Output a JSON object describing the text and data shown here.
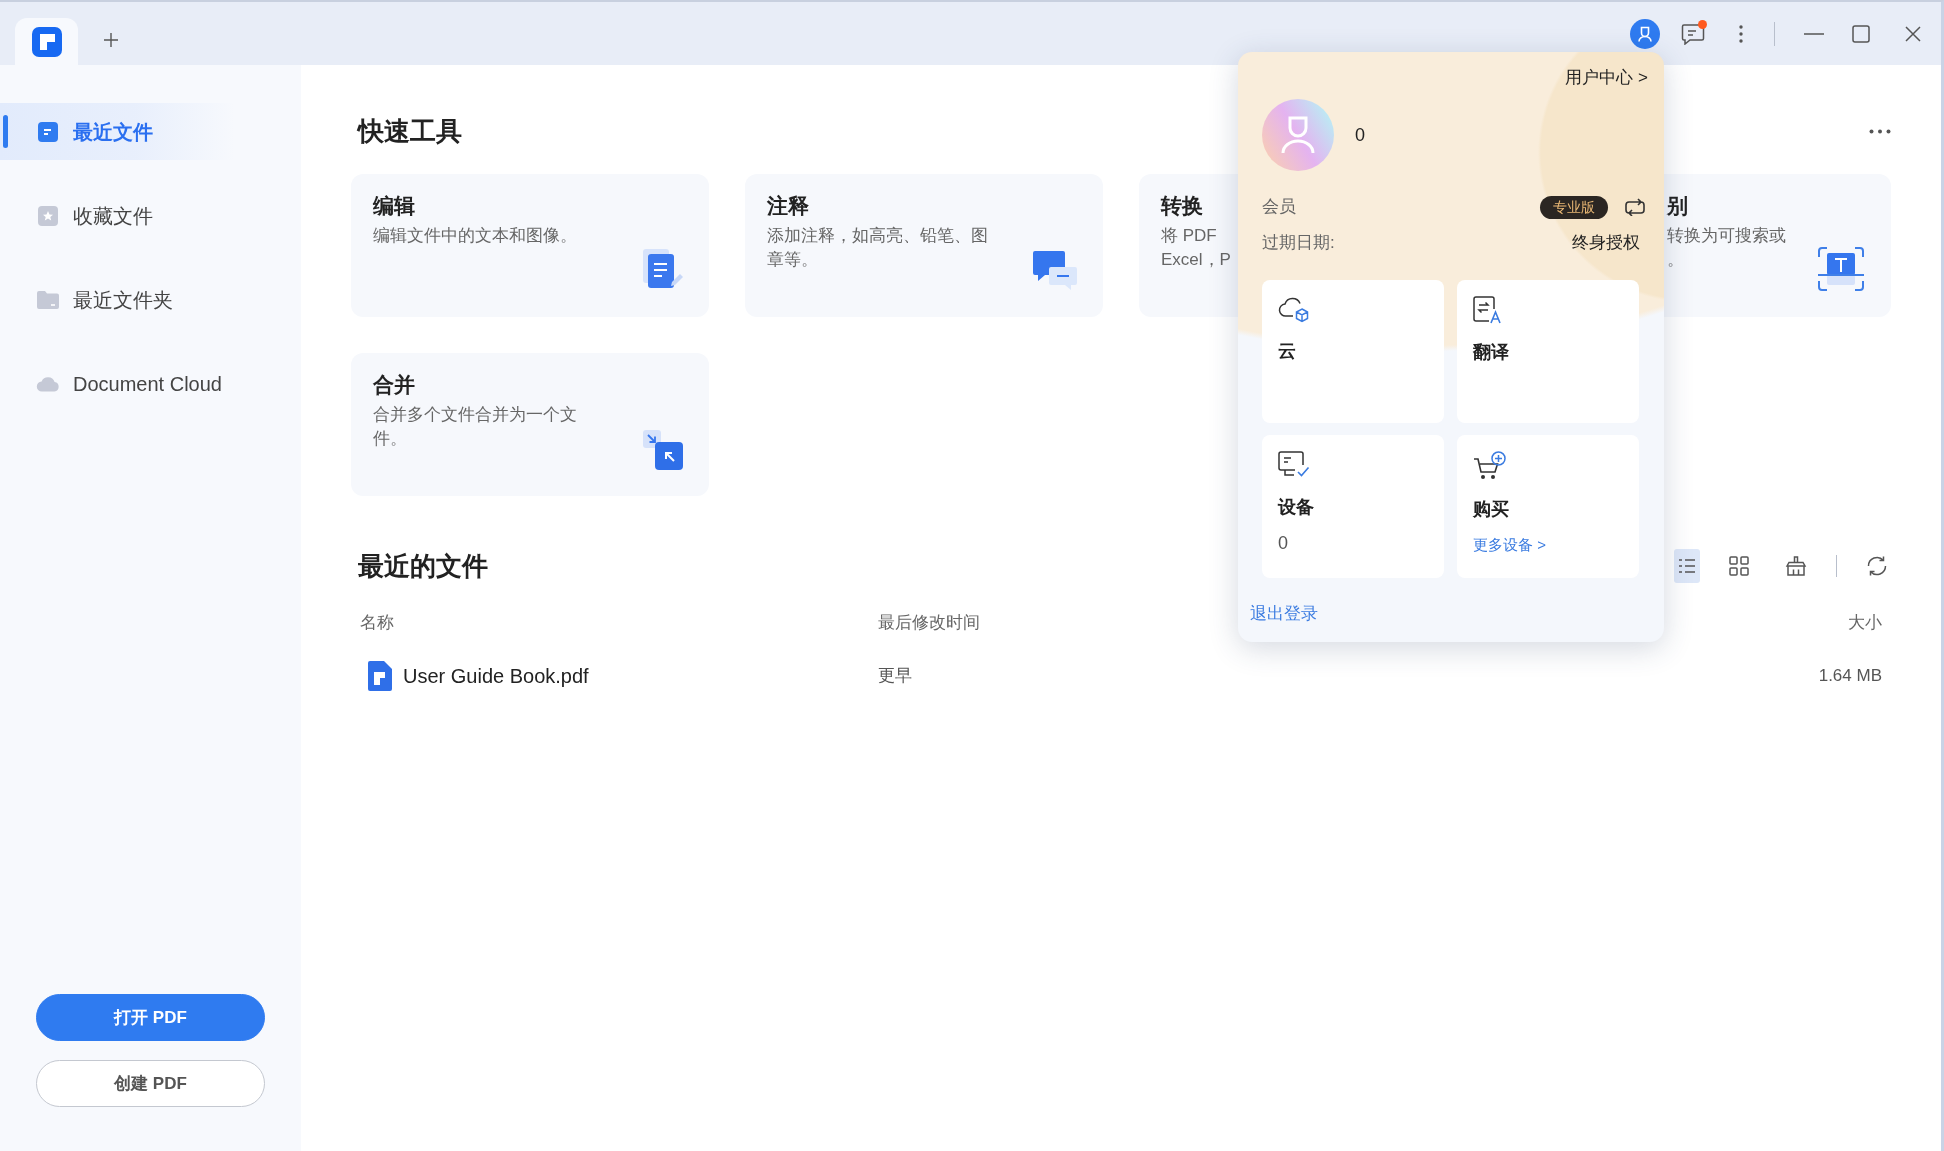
{
  "title_bar": {
    "tabs": [
      {
        "kind": "home",
        "selected": true
      }
    ],
    "notification": true
  },
  "sidebar": {
    "items": [
      {
        "kind": "recent",
        "label": "最近文件",
        "selected": true
      },
      {
        "kind": "starred",
        "label": "收藏文件",
        "selected": false
      },
      {
        "kind": "folder",
        "label": "最近文件夹",
        "selected": false
      },
      {
        "kind": "cloud",
        "label": "Document Cloud",
        "selected": false
      }
    ],
    "buttons": [
      {
        "kind": "open",
        "label": "打开 PDF"
      },
      {
        "kind": "create",
        "label": "创建 PDF"
      }
    ]
  },
  "quick_tools": {
    "title": "快速工具",
    "cards": [
      {
        "kind": "edit",
        "title": "编辑",
        "description": [
          "编辑文件中的文本和图像。"
        ]
      },
      {
        "kind": "annotate",
        "title": "注释",
        "description": [
          "添加注释，如高亮、铅笔、图",
          "章等。"
        ]
      },
      {
        "kind": "convert",
        "title": "转换",
        "description": [
          "将 PDF",
          "Excel，P"
        ]
      },
      {
        "kind": "ocr",
        "title": "别",
        "description": [
          "转换为可搜索或",
          "。"
        ]
      },
      {
        "kind": "merge",
        "title": "合并",
        "description": [
          "合并多个文件合并为一个文",
          "件。"
        ]
      }
    ]
  },
  "recent_files": {
    "title": "最近的文件",
    "view_modes": [
      {
        "kind": "list",
        "selected": true
      },
      {
        "kind": "grid",
        "selected": false
      }
    ],
    "columns": [
      "名称",
      "最后修改时间",
      "大小"
    ],
    "rows": [
      {
        "name": "User Guide Book.pdf",
        "modified": "更早",
        "size": "1.64 MB"
      }
    ]
  },
  "account_popup": {
    "user_center_link": "用户中心 >",
    "username": "0",
    "membership_label": "会员",
    "plan_badge": "专业版",
    "expiry_label": "过期日期:",
    "expiry_value": "终身授权",
    "tiles": [
      {
        "kind": "cloud",
        "label": "云"
      },
      {
        "kind": "translate",
        "label": "翻译"
      },
      {
        "kind": "devices",
        "label": "设备",
        "value": "0"
      },
      {
        "kind": "purchase",
        "label": "购买",
        "link": "更多设备 >"
      }
    ],
    "logout": "退出登录"
  }
}
